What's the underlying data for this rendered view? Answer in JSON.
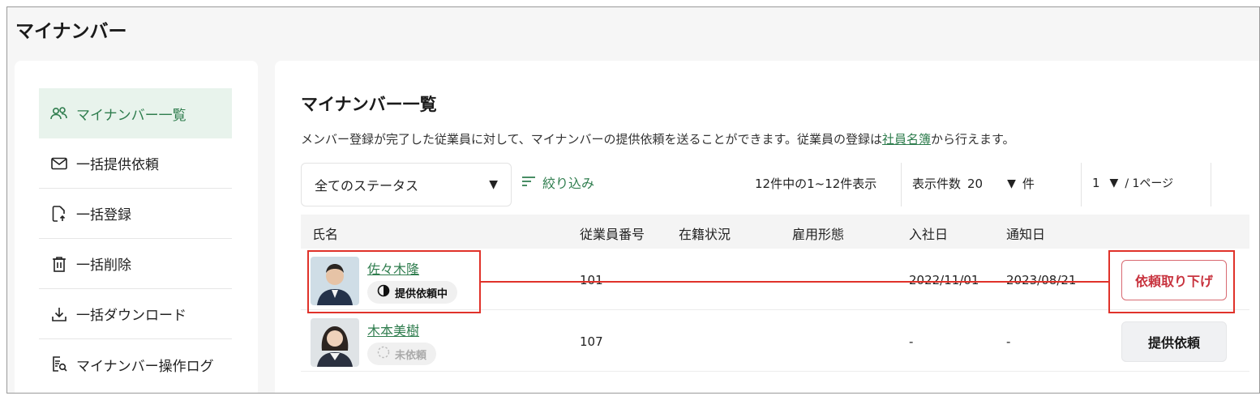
{
  "page": {
    "title": "マイナンバー"
  },
  "sidebar": {
    "items": [
      {
        "label": "マイナンバー一覧",
        "icon": "users-icon",
        "active": true
      },
      {
        "label": "一括提供依頼",
        "icon": "mail-icon"
      },
      {
        "label": "一括登録",
        "icon": "file-upload-icon"
      },
      {
        "label": "一括削除",
        "icon": "trash-icon"
      },
      {
        "label": "一括ダウンロード",
        "icon": "download-icon"
      },
      {
        "label": "マイナンバー操作ログ",
        "icon": "log-search-icon"
      }
    ]
  },
  "main": {
    "title": "マイナンバー一覧",
    "desc_before": "メンバー登録が完了した従業員に対して、マイナンバーの提供依頼を送ることができます。従業員の登録は",
    "desc_link": "社員名簿",
    "desc_after": "から行えます。",
    "status_select": "全てのステータス",
    "filter_label": "絞り込み",
    "count_text": "12件中の1~12件表示",
    "perpage_label": "表示件数",
    "perpage_value": "20",
    "perpage_unit": "件",
    "page_value": "1",
    "page_suffix": "/ 1ページ"
  },
  "table": {
    "headers": [
      "氏名",
      "従業員番号",
      "在籍状況",
      "雇用形態",
      "入社日",
      "通知日"
    ],
    "rows": [
      {
        "name": "佐々木隆",
        "status": "提供依頼中",
        "employee_no": "101",
        "employment": "",
        "type": "",
        "join_date": "2022/11/01",
        "notice_date": "2023/08/21",
        "action": "依頼取り下げ"
      },
      {
        "name": "木本美樹",
        "status": "未依頼",
        "employee_no": "107",
        "employment": "",
        "type": "",
        "join_date": "-",
        "notice_date": "-",
        "action": "提供依頼"
      }
    ]
  },
  "colors": {
    "accent": "#2f7d4e",
    "active_bg": "#e8f3ec",
    "danger": "#c8343f",
    "annotation": "#e0322a"
  }
}
